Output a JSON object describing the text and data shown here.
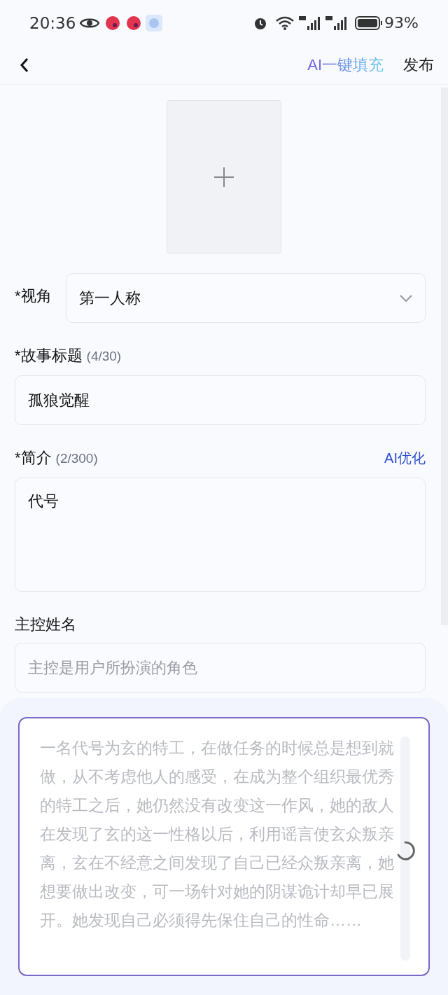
{
  "status_bar": {
    "time": "20:36",
    "battery": "93%"
  },
  "header": {
    "ai_fill": "AI一键填充",
    "publish": "发布"
  },
  "perspective": {
    "label": "*视角",
    "value": "第一人称"
  },
  "title_field": {
    "label": "*故事标题",
    "count": "(4/30)",
    "value": "孤狼觉醒"
  },
  "intro_field": {
    "label": "*简介",
    "count": "(2/300)",
    "action": "AI优化",
    "value": "代号"
  },
  "protagonist": {
    "label": "主控姓名",
    "placeholder": "主控是用户所扮演的角色"
  },
  "ai_panel": {
    "text": "一名代号为玄的特工，在做任务的时候总是想到就做，从不考虑他人的感受，在成为整个组织最优秀的特工之后，她仍然没有改变这一作风，她的敌人在发现了玄的这一性格以后，利用谣言使玄众叛亲离，玄在不经意之间发现了自己已经众叛亲离，她想要做出改变，可一场针对她的阴谋诡计却早已展开。她发现自己必须得先保住自己的性命……",
    "loading": true
  }
}
